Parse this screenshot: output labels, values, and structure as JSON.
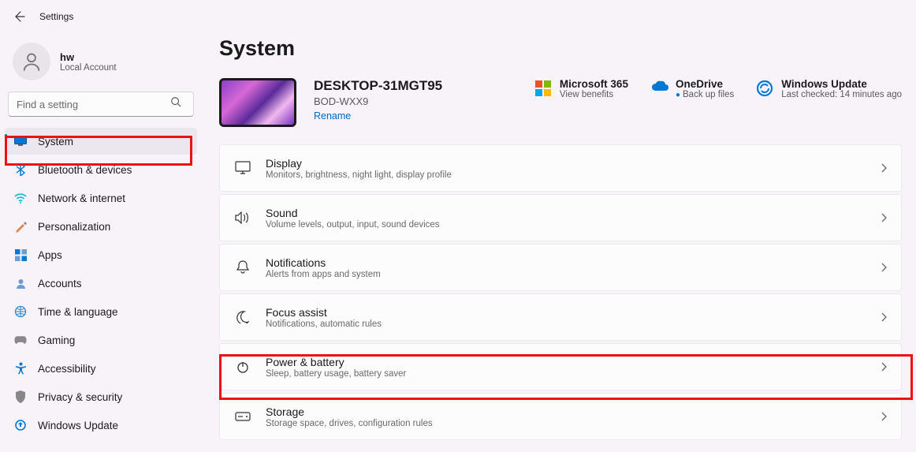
{
  "app": {
    "title": "Settings"
  },
  "user": {
    "name": "hw",
    "sub": "Local Account"
  },
  "search": {
    "placeholder": "Find a setting"
  },
  "nav": [
    {
      "label": "System",
      "icon": "system",
      "active": true
    },
    {
      "label": "Bluetooth & devices",
      "icon": "bluetooth"
    },
    {
      "label": "Network & internet",
      "icon": "network"
    },
    {
      "label": "Personalization",
      "icon": "personalization"
    },
    {
      "label": "Apps",
      "icon": "apps"
    },
    {
      "label": "Accounts",
      "icon": "accounts"
    },
    {
      "label": "Time & language",
      "icon": "time"
    },
    {
      "label": "Gaming",
      "icon": "gaming"
    },
    {
      "label": "Accessibility",
      "icon": "accessibility"
    },
    {
      "label": "Privacy & security",
      "icon": "privacy"
    },
    {
      "label": "Windows Update",
      "icon": "update"
    }
  ],
  "page": {
    "title": "System"
  },
  "device": {
    "name": "DESKTOP-31MGT95",
    "model": "BOD-WXX9",
    "rename": "Rename"
  },
  "header_cards": {
    "ms365": {
      "title": "Microsoft 365",
      "sub": "View benefits"
    },
    "onedrive": {
      "title": "OneDrive",
      "sub": "Back up files"
    },
    "update": {
      "title": "Windows Update",
      "sub": "Last checked: 14 minutes ago"
    }
  },
  "settings": [
    {
      "title": "Display",
      "sub": "Monitors, brightness, night light, display profile",
      "icon": "display"
    },
    {
      "title": "Sound",
      "sub": "Volume levels, output, input, sound devices",
      "icon": "sound"
    },
    {
      "title": "Notifications",
      "sub": "Alerts from apps and system",
      "icon": "notifications"
    },
    {
      "title": "Focus assist",
      "sub": "Notifications, automatic rules",
      "icon": "focus"
    },
    {
      "title": "Power & battery",
      "sub": "Sleep, battery usage, battery saver",
      "icon": "power"
    },
    {
      "title": "Storage",
      "sub": "Storage space, drives, configuration rules",
      "icon": "storage"
    }
  ]
}
